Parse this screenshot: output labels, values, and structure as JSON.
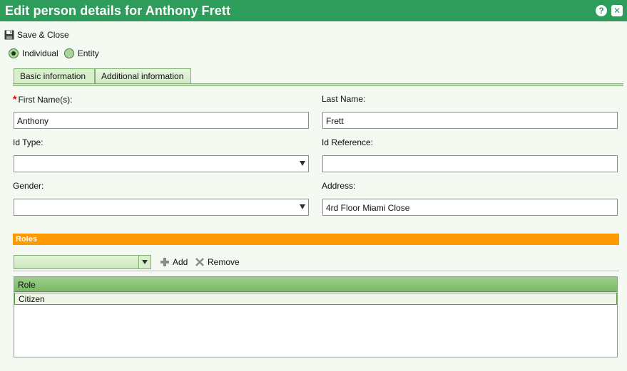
{
  "window": {
    "title": "Edit person details for Anthony Frett",
    "help_label": "?",
    "close_label": "✕"
  },
  "toolbar": {
    "save_close_label": "Save & Close"
  },
  "entity_type": {
    "options": [
      "Individual",
      "Entity"
    ],
    "selected": "Individual"
  },
  "tabs": [
    {
      "label": "Basic information",
      "active": true
    },
    {
      "label": "Additional information",
      "active": false
    }
  ],
  "form": {
    "first_name": {
      "label": "First Name(s):",
      "value": "Anthony",
      "required": true
    },
    "last_name": {
      "label": "Last Name:",
      "value": "Frett"
    },
    "id_type": {
      "label": "Id Type:",
      "value": ""
    },
    "id_reference": {
      "label": "Id Reference:",
      "value": ""
    },
    "gender": {
      "label": "Gender:",
      "value": ""
    },
    "address": {
      "label": "Address:",
      "value": "4rd Floor Miami Close"
    }
  },
  "roles": {
    "section_title": "Roles",
    "add_label": "Add",
    "remove_label": "Remove",
    "column_header": "Role",
    "rows": [
      "Citizen"
    ]
  },
  "colors": {
    "titlebar": "#2e9c5b",
    "section_bar": "#ff9900",
    "required_marker": "#e00000"
  }
}
